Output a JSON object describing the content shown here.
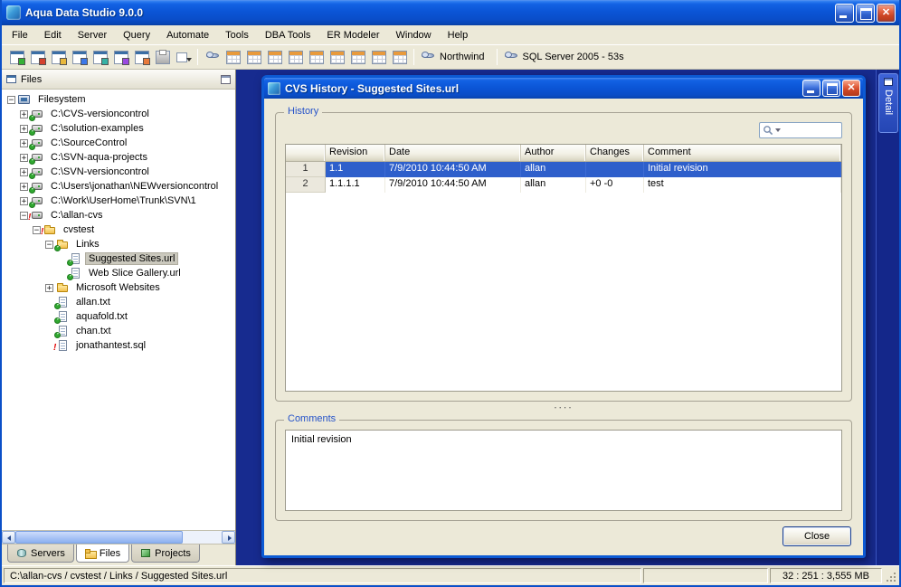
{
  "window": {
    "title": "Aqua Data Studio 9.0.0",
    "menu": [
      "File",
      "Edit",
      "Server",
      "Query",
      "Automate",
      "Tools",
      "DBA Tools",
      "ER Modeler",
      "Window",
      "Help"
    ],
    "toolbar": {
      "groups": [
        [
          "connect-server-icon",
          "register-server-icon",
          "schema-browser-icon",
          "query-analyzer-icon",
          "import-tool-icon",
          "export-tool-icon",
          "procedure-editor-icon",
          "print-icon",
          "options-dropdown-icon"
        ],
        [
          "db-tool-icon",
          "table-grid-icon-1",
          "table-grid-icon-2",
          "table-grid-icon-3",
          "table-grid-icon-4",
          "table-grid-icon-5",
          "table-grid-icon-6",
          "table-grid-icon-7",
          "table-grid-icon-8",
          "table-grid-icon-9"
        ]
      ],
      "contexts": [
        {
          "icon": "database-icon",
          "label": "Northwind"
        },
        {
          "icon": "server-icon",
          "label": "SQL Server 2005 - 53s"
        }
      ]
    }
  },
  "files_panel": {
    "title": "Files",
    "tree": [
      {
        "label": "Filesystem",
        "depth": 0,
        "icon": "filesystem",
        "badge": null,
        "exp": "minus",
        "selected": false
      },
      {
        "label": "C:\\CVS-versioncontrol",
        "depth": 1,
        "icon": "drive",
        "badge": "check",
        "exp": "plus",
        "selected": false
      },
      {
        "label": "C:\\solution-examples",
        "depth": 1,
        "icon": "drive",
        "badge": "check",
        "exp": "plus",
        "selected": false
      },
      {
        "label": "C:\\SourceControl",
        "depth": 1,
        "icon": "drive",
        "badge": "check",
        "exp": "plus",
        "selected": false
      },
      {
        "label": "C:\\SVN-aqua-projects",
        "depth": 1,
        "icon": "drive",
        "badge": "check",
        "exp": "plus",
        "selected": false
      },
      {
        "label": "C:\\SVN-versioncontrol",
        "depth": 1,
        "icon": "drive",
        "badge": "check",
        "exp": "plus",
        "selected": false
      },
      {
        "label": "C:\\Users\\jonathan\\NEWversioncontrol",
        "depth": 1,
        "icon": "drive",
        "badge": "check",
        "exp": "plus",
        "selected": false
      },
      {
        "label": "C:\\Work\\UserHome\\Trunk\\SVN\\1",
        "depth": 1,
        "icon": "drive",
        "badge": "check",
        "exp": "plus",
        "selected": false
      },
      {
        "label": "C:\\allan-cvs",
        "depth": 1,
        "icon": "drive",
        "badge": "error",
        "exp": "minus",
        "selected": false
      },
      {
        "label": "cvstest",
        "depth": 2,
        "icon": "folder",
        "badge": "error",
        "exp": "minus",
        "selected": false
      },
      {
        "label": "Links",
        "depth": 3,
        "icon": "folder",
        "badge": "check",
        "exp": "minus",
        "selected": false
      },
      {
        "label": "Suggested Sites.url",
        "depth": 4,
        "icon": "file",
        "badge": "check",
        "exp": null,
        "selected": true
      },
      {
        "label": "Web Slice Gallery.url",
        "depth": 4,
        "icon": "file",
        "badge": "check",
        "exp": null,
        "selected": false
      },
      {
        "label": "Microsoft Websites",
        "depth": 3,
        "icon": "folder",
        "badge": null,
        "exp": "plus",
        "selected": false
      },
      {
        "label": "allan.txt",
        "depth": 3,
        "icon": "file",
        "badge": "check",
        "exp": null,
        "selected": false
      },
      {
        "label": "aquafold.txt",
        "depth": 3,
        "icon": "file",
        "badge": "check",
        "exp": null,
        "selected": false
      },
      {
        "label": "chan.txt",
        "depth": 3,
        "icon": "file",
        "badge": "check",
        "exp": null,
        "selected": false
      },
      {
        "label": "jonathantest.sql",
        "depth": 3,
        "icon": "file",
        "badge": "error",
        "exp": null,
        "selected": false
      }
    ],
    "tabs": [
      {
        "label": "Servers",
        "icon": "servers-tab-icon",
        "active": false
      },
      {
        "label": "Files",
        "icon": "files-tab-icon",
        "active": true
      },
      {
        "label": "Projects",
        "icon": "projects-tab-icon",
        "active": false
      }
    ]
  },
  "detail_tab": "Detail",
  "dialog": {
    "title": "CVS History - Suggested Sites.url",
    "history_label": "History",
    "comments_label": "Comments",
    "comments_text": "Initial revision",
    "close_label": "Close",
    "search_value": "",
    "table": {
      "columns": [
        "",
        "Revision",
        "Date",
        "Author",
        "Changes",
        "Comment"
      ],
      "rows": [
        {
          "cells": [
            "1",
            "1.1",
            "7/9/2010 10:44:50 AM",
            "allan",
            "",
            "Initial revision"
          ],
          "selected": true
        },
        {
          "cells": [
            "2",
            "1.1.1.1",
            "7/9/2010 10:44:50 AM",
            "allan",
            "+0 -0",
            "test"
          ],
          "selected": false
        }
      ]
    }
  },
  "statusbar": {
    "path": "C:\\allan-cvs / cvstest / Links / Suggested Sites.url",
    "memory": "32 : 251 : 3,555 MB"
  }
}
